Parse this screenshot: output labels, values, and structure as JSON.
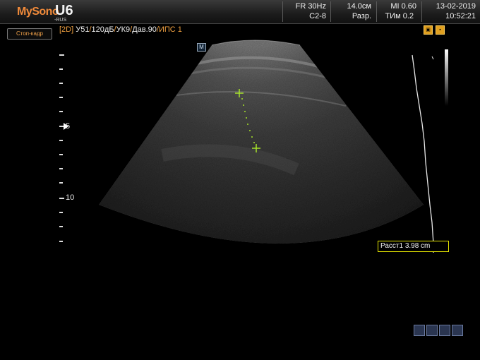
{
  "header": {
    "brand": "MySono",
    "model": "U6",
    "brand_sub": "-RUS",
    "frame_rate": "FR 30Hz",
    "probe": "C2-8",
    "depth": "14.0см",
    "resolution": "Разр.",
    "mi": "MI  0.60",
    "tim": "ТИм 0.2",
    "date": "13-02-2019",
    "time": "10:52:21"
  },
  "freeze_button": "Стоп-кадр",
  "image_params": {
    "mode": "[2D]",
    "gain": "У51",
    "dyn": "120дБ",
    "enh": "УК9",
    "power": "Дав.90",
    "persist": "ИПС 1"
  },
  "marker": "M",
  "depth_scale": {
    "labels": [
      "5",
      "10"
    ]
  },
  "measurement": {
    "label": "Расст1 3.98 cm"
  },
  "colors": {
    "logo_orange": "#f08a3a",
    "param_orange": "#f0a040",
    "caliper_green": "#a6e22a",
    "measure_border": "#e6e600"
  },
  "icons": {
    "top_right": [
      "image-settings-icon",
      "lock-icon"
    ],
    "bottom_right": [
      "disk-icon",
      "monitor-icon",
      "usb-icon",
      "network-icon"
    ]
  }
}
